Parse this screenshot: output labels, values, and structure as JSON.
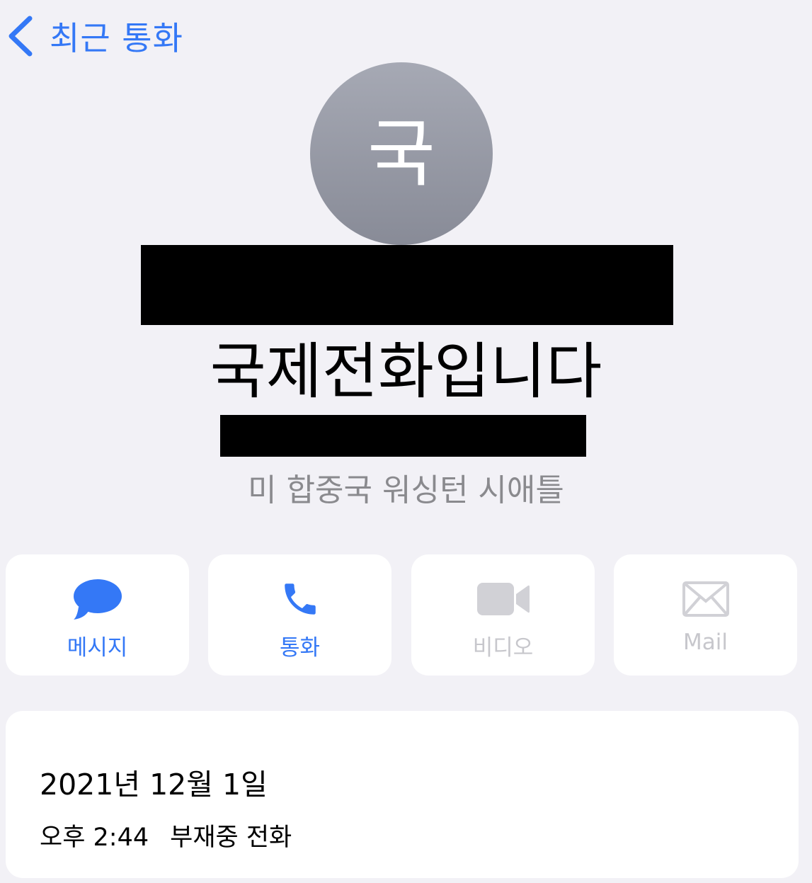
{
  "nav": {
    "back_label": "최근 통화",
    "back_icon": "chevron-left-icon",
    "accent": "#3478f6"
  },
  "contact": {
    "avatar_initial": "국",
    "name": "국제전화입니다",
    "location": "미 합중국 워싱턴 시애틀"
  },
  "actions": [
    {
      "label": "메시지",
      "icon": "message-bubble-icon",
      "enabled": true
    },
    {
      "label": "통화",
      "icon": "phone-icon",
      "enabled": true
    },
    {
      "label": "비디오",
      "icon": "video-camera-icon",
      "enabled": false
    },
    {
      "label": "Mail",
      "icon": "mail-envelope-icon",
      "enabled": false
    }
  ],
  "call_history": {
    "date": "2021년 12월 1일",
    "entries": [
      {
        "time": "오후 2:44",
        "type": "부재중 전화"
      }
    ]
  }
}
